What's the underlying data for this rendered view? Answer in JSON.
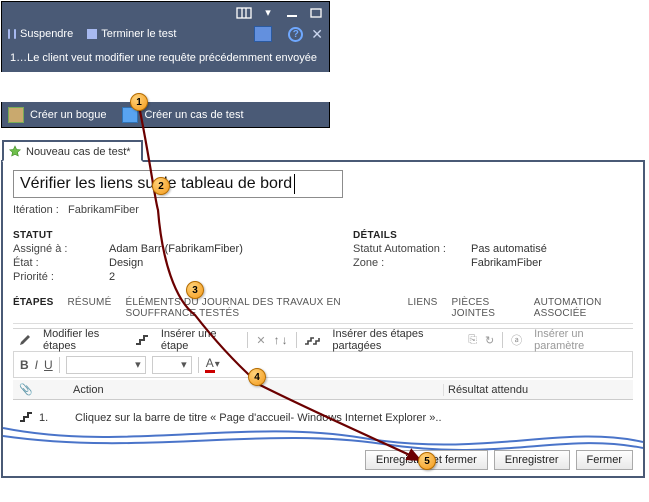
{
  "callouts": [
    "1",
    "2",
    "3",
    "4",
    "5"
  ],
  "topwin": {
    "suspend": "Suspendre",
    "terminate": "Terminer le test",
    "desc": "1…Le client veut modifier une requête précédemment envoyée",
    "createBug": "Créer un bogue",
    "createTestCase": "Créer un cas de test"
  },
  "testcase": {
    "tabTitle": "Nouveau cas de test*",
    "title": "Vérifier les liens sur le tableau de bord",
    "iterationLabel": "Itération :",
    "iterationValue": "FabrikamFiber",
    "statusHeader": "STATUT",
    "detailsHeader": "DÉTAILS",
    "status": {
      "assignToLabel": "Assigné à :",
      "assignToValue": "Adam Barr (FabrikamFiber)",
      "stateLabel": "État :",
      "stateValue": "Design",
      "priorityLabel": "Priorité :",
      "priorityValue": "2"
    },
    "details": {
      "autoLabel": "Statut Automation :",
      "autoValue": "Pas automatisé",
      "zoneLabel": "Zone :",
      "zoneValue": "FabrikamFiber"
    },
    "tabs": {
      "steps": "ÉTAPES",
      "summary": "RÉSUMÉ",
      "backlog": "ÉLÉMENTS DU JOURNAL DES TRAVAUX EN SOUFFRANCE TESTÉS",
      "links": "LIENS",
      "attachments": "PIÈCES JOINTES",
      "automation": "AUTOMATION ASSOCIÉE"
    },
    "toolbar": {
      "editSteps": "Modifier les étapes",
      "insertStep": "Insérer une étape",
      "insertShared": "Insérer des étapes partagées",
      "insertParam": "Insérer un paramètre"
    },
    "grid": {
      "actionHeader": "Action",
      "expectedHeader": "Résultat attendu",
      "step1Num": "1.",
      "step1Action": "Cliquez sur la barre de titre « Page d'accueil- Windows Internet Explorer ».."
    },
    "buttons": {
      "saveClose": "Enregistrer et fermer",
      "save": "Enregistrer",
      "close": "Fermer"
    }
  }
}
